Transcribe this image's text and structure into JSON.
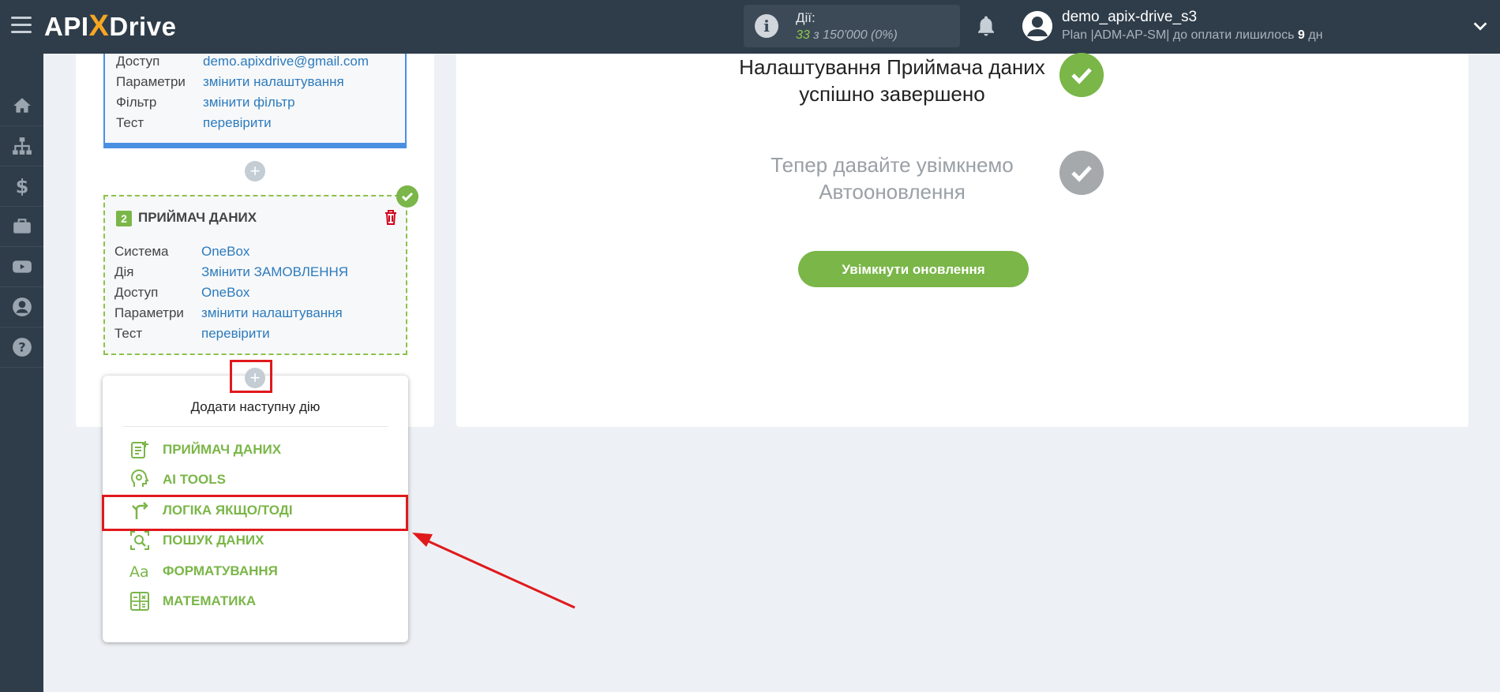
{
  "header": {
    "logo_api": "API",
    "logo_x": "X",
    "logo_drive": "Drive",
    "actions_label": "Дії:",
    "actions_used": "33",
    "actions_of": "з",
    "actions_total": "150'000",
    "actions_percent": "(0%)",
    "user_name": "demo_apix-drive_s3",
    "plan_prefix": "Plan |ADM-AP-SM| до оплати лишилось",
    "plan_days": "9",
    "plan_suffix": "дн"
  },
  "sidebar": {
    "items": [
      "home-icon",
      "sitemap-icon",
      "dollar-icon",
      "briefcase-icon",
      "youtube-icon",
      "user-icon",
      "help-icon"
    ]
  },
  "block1": {
    "rows": [
      {
        "key": "Доступ",
        "value": "demo.apixdrive@gmail.com"
      },
      {
        "key": "Параметри",
        "value": "змінити налаштування"
      },
      {
        "key": "Фільтр",
        "value": "змінити фільтр"
      },
      {
        "key": "Тест",
        "value": "перевірити"
      }
    ]
  },
  "block2": {
    "number": "2",
    "title": "ПРИЙМАЧ ДАНИХ",
    "rows": [
      {
        "key": "Система",
        "value": "OneBox"
      },
      {
        "key": "Дія",
        "value": "Змінити ЗАМОВЛЕННЯ"
      },
      {
        "key": "Доступ",
        "value": "OneBox"
      },
      {
        "key": "Параметри",
        "value": "змінити налаштування"
      },
      {
        "key": "Тест",
        "value": "перевірити"
      }
    ]
  },
  "popup": {
    "plus_symbol": "+",
    "title": "Додати наступну дію",
    "items": [
      {
        "label": "ПРИЙМАЧ ДАНИХ",
        "icon": "receiver-icon"
      },
      {
        "label": "AI TOOLS",
        "icon": "ai-head-icon"
      },
      {
        "label": "ЛОГІКА ЯКЩО/ТОДІ",
        "icon": "branch-icon"
      },
      {
        "label": "ПОШУК ДАНИХ",
        "icon": "search-data-icon"
      },
      {
        "label": "ФОРМАТУВАННЯ",
        "icon": "format-icon"
      },
      {
        "label": "МАТЕМАТИКА",
        "icon": "math-icon"
      }
    ]
  },
  "main": {
    "step1_line1": "Налаштування Приймача даних",
    "step1_line2": "успішно завершено",
    "step2_line1": "Тепер давайте увімкнемо",
    "step2_line2": "Автооновлення",
    "enable_button": "Увімкнути оновлення"
  },
  "colors": {
    "topbar": "#2f3d4a",
    "accent_green": "#7ab648",
    "link_blue": "#2c7bbd",
    "highlight_red": "#e0191c"
  }
}
